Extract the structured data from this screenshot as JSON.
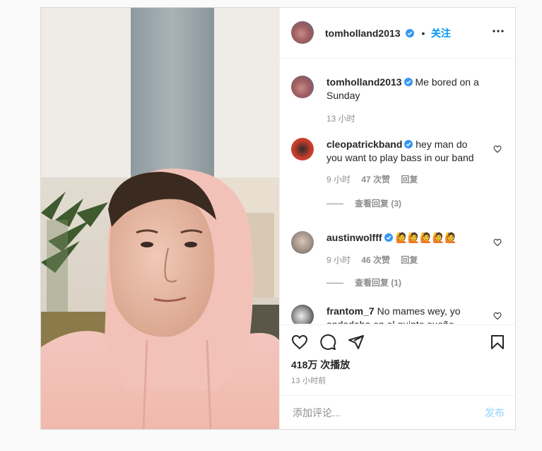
{
  "post": {
    "author": "tomholland2013",
    "follow_label": "关注",
    "dot": "•",
    "more_icon": "more-horizontal-icon",
    "verified_icon": "verified-badge-icon"
  },
  "caption": {
    "username": "tomholland2013",
    "text": "Me bored on a Sunday",
    "time": "13 小时"
  },
  "comments": [
    {
      "username": "cleopatrickband",
      "verified": true,
      "text": "hey man do you want to play bass in our band",
      "time": "9 小时",
      "likes": "47 次赞",
      "reply_label": "回复",
      "view_replies": "查看回复 (3)"
    },
    {
      "username": "austinwolfff",
      "verified": true,
      "text": "🙋🙋🙋🙋🙋",
      "time": "9 小时",
      "likes": "46 次赞",
      "reply_label": "回复",
      "view_replies": "查看回复 (1)"
    },
    {
      "username": "frantom_7",
      "verified": false,
      "text": "No mames wey, yo andadaba en el quinto sueño."
    }
  ],
  "actions": {
    "views": "418万 次播放",
    "timestamp": "13 小时前"
  },
  "add_comment": {
    "placeholder": "添加评论...",
    "post_label": "发布"
  },
  "colors": {
    "accent": "#0095f6",
    "post_disabled": "#b2dffc",
    "muted": "#8e8e8e"
  }
}
